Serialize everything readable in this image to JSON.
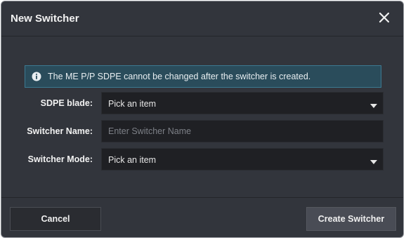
{
  "dialog": {
    "title": "New Switcher",
    "info_message": "The ME P/P SDPE cannot be changed after the switcher is created."
  },
  "form": {
    "sdpe_blade": {
      "label": "SDPE blade:",
      "value": "Pick an item"
    },
    "switcher_name": {
      "label": "Switcher Name:",
      "value": "",
      "placeholder": "Enter Switcher Name"
    },
    "switcher_mode": {
      "label": "Switcher Mode:",
      "value": "Pick an item"
    }
  },
  "buttons": {
    "cancel": "Cancel",
    "create": "Create Switcher"
  },
  "colors": {
    "dialog_bg": "#32353c",
    "input_bg": "#1f2024",
    "info_bg": "#2a4c5b",
    "info_border": "#3c7a91",
    "primary_button_bg": "#494c55"
  },
  "icons": {
    "close": "close-icon",
    "info": "info-icon",
    "dropdown": "caret-down-icon"
  }
}
